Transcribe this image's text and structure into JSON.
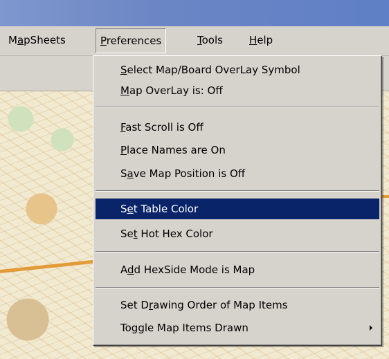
{
  "menubar": {
    "items": [
      {
        "label": "MapSheets",
        "mnemonic_pre": "M",
        "mnemonic": "a",
        "mnemonic_post": "pSheets"
      },
      {
        "label": "Preferences",
        "mnemonic_pre": "",
        "mnemonic": "P",
        "mnemonic_post": "references"
      },
      {
        "label": "Tools",
        "mnemonic_pre": "",
        "mnemonic": "T",
        "mnemonic_post": "ools"
      },
      {
        "label": "Help",
        "mnemonic_pre": "",
        "mnemonic": "H",
        "mnemonic_post": "elp"
      }
    ],
    "active": "Preferences"
  },
  "preferences_menu": {
    "items": [
      {
        "label": "Select Map/Board OverLay Symbol",
        "pre": "",
        "u": "S",
        "post": "elect Map/Board OverLay Symbol"
      },
      {
        "label": "Map OverLay is: Off",
        "pre": "",
        "u": "M",
        "post": "ap OverLay is: Off"
      },
      {
        "label": "Fast Scroll is Off",
        "pre": "",
        "u": "F",
        "post": "ast Scroll is Off"
      },
      {
        "label": "Place Names are On",
        "pre": "",
        "u": "P",
        "post": "lace Names are On"
      },
      {
        "label": "Save Map Position is Off",
        "pre": "S",
        "u": "a",
        "post": "ve Map Position is Off"
      },
      {
        "label": "Set Table Color",
        "pre": "S",
        "u": "e",
        "post": "t Table Color"
      },
      {
        "label": "Set Hot Hex Color",
        "pre": "Se",
        "u": "t",
        "post": " Hot Hex Color"
      },
      {
        "label": "Add HexSide Mode is Map",
        "pre": "A",
        "u": "d",
        "post": "d HexSide Mode is Map"
      },
      {
        "label": "Set Drawing Order of Map Items",
        "pre": "Set D",
        "u": "r",
        "post": "awing Order of Map Items"
      },
      {
        "label": "Toggle Map Items Drawn",
        "pre": "To",
        "u": "g",
        "post": "gle Map Items Drawn"
      }
    ],
    "highlighted": "Set Table Color",
    "submenu_arrow_on": "Toggle Map Items Drawn"
  },
  "colors": {
    "highlight": "#0a246a",
    "menu_bg": "#d6d3cc",
    "titlebar": "#6b86c4"
  }
}
